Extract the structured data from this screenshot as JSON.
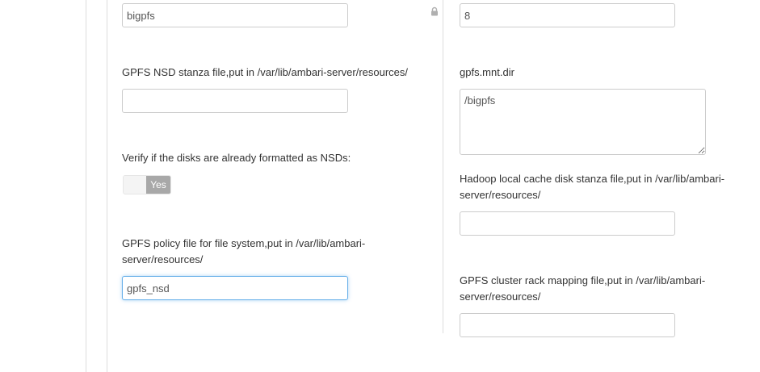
{
  "left_column": {
    "name_input": {
      "value": "bigpfs"
    },
    "nsd_stanza": {
      "label": "GPFS NSD stanza file,put in /var/lib/ambari-server/resources/",
      "value": ""
    },
    "verify_disks": {
      "label": "Verify if the disks are already formatted as NSDs:",
      "toggle_label": "Yes"
    },
    "policy_file": {
      "label_line1": "GPFS policy file for file system,put in /var/lib/ambari-",
      "label_line2": "server/resources/",
      "value": "gpfs_nsd"
    }
  },
  "right_column": {
    "top_input": {
      "value": "8"
    },
    "mnt_dir": {
      "label": "gpfs.mnt.dir",
      "value": "/bigpfs"
    },
    "hadoop_cache": {
      "label_line1": "Hadoop local cache disk stanza file,put in /var/lib/ambari-",
      "label_line2": "server/resources/",
      "value": ""
    },
    "rack_mapping": {
      "label_line1": "GPFS cluster rack mapping file,put in /var/lib/ambari-",
      "label_line2": "server/resources/",
      "value": ""
    }
  },
  "icons": {
    "lock": "lock-icon"
  }
}
